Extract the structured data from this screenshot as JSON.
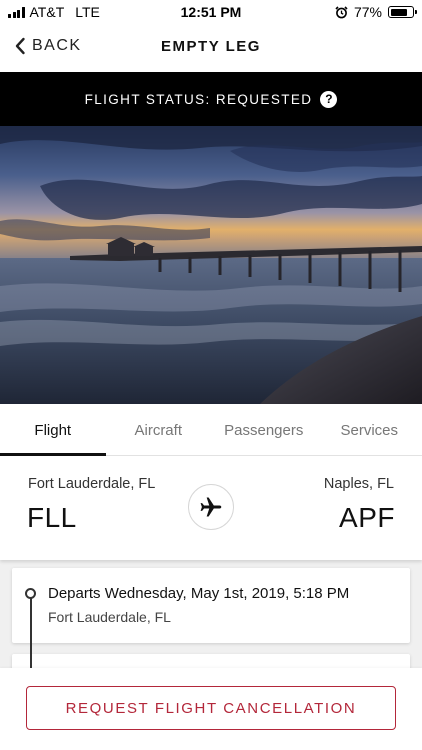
{
  "status_bar": {
    "carrier": "AT&T",
    "network": "LTE",
    "time": "12:51 PM",
    "battery": "77%",
    "battery_level": 0.77
  },
  "nav": {
    "back_label": "BACK",
    "title": "EMPTY LEG"
  },
  "banner": {
    "text": "FLIGHT STATUS: REQUESTED",
    "help_glyph": "?"
  },
  "tabs": [
    {
      "label": "Flight",
      "active": true
    },
    {
      "label": "Aircraft",
      "active": false
    },
    {
      "label": "Passengers",
      "active": false
    },
    {
      "label": "Services",
      "active": false
    }
  ],
  "route": {
    "origin_city": "Fort Lauderdale, FL",
    "origin_code": "FLL",
    "dest_city": "Naples, FL",
    "dest_code": "APF"
  },
  "timeline": [
    {
      "title": "Departs Wednesday, May 1st, 2019, 5:18 PM",
      "subtitle": "Fort Lauderdale, FL"
    }
  ],
  "actions": {
    "cancel_label": "REQUEST FLIGHT CANCELLATION"
  },
  "colors": {
    "accent": "#b3273a",
    "banner_bg": "#000000",
    "tab_active": "#111111"
  },
  "icons": {
    "back": "chevron-left-icon",
    "help": "question-circle-icon",
    "plane": "airplane-icon",
    "alarm": "alarm-clock-icon",
    "battery": "battery-icon",
    "signal": "signal-bars-icon"
  }
}
